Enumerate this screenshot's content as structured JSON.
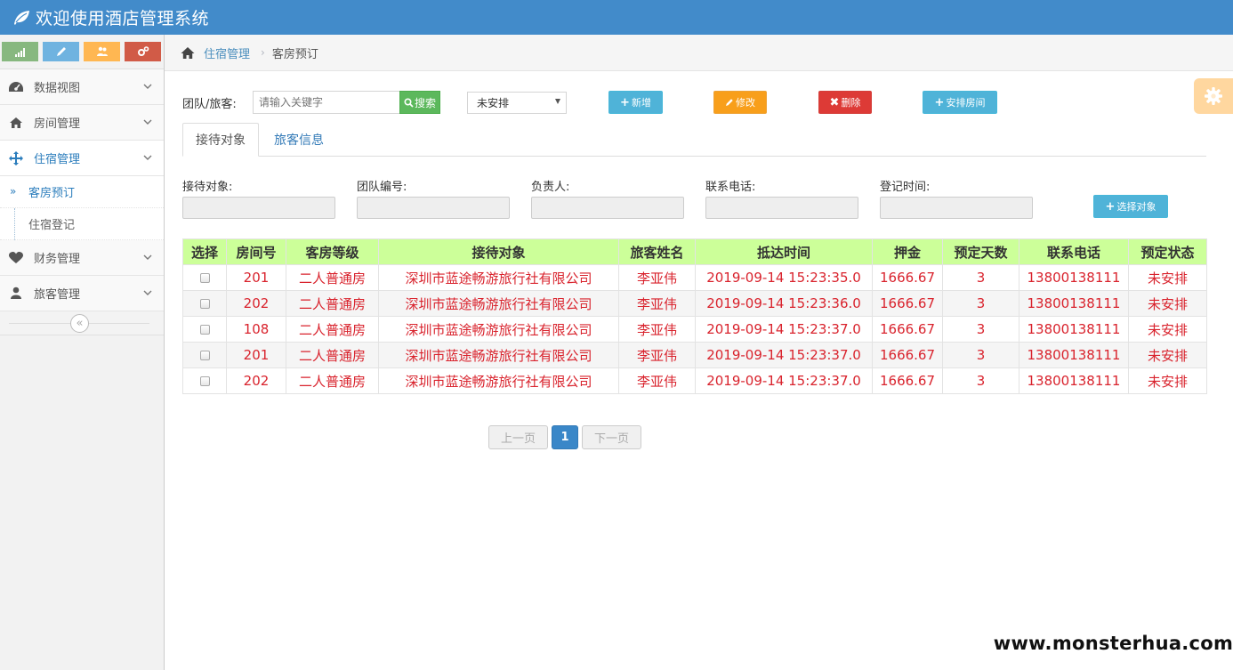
{
  "app": {
    "title": "欢迎使用酒店管理系统",
    "brand_color": "#428bca"
  },
  "shortcuts": [
    {
      "icon": "signal-icon",
      "color": "#87b87f"
    },
    {
      "icon": "pencil-icon",
      "color": "#6fb3e0"
    },
    {
      "icon": "users-icon",
      "color": "#ffb752"
    },
    {
      "icon": "cogs-icon",
      "color": "#d15b47"
    }
  ],
  "sidebar": {
    "items": [
      {
        "label": "数据视图",
        "icon": "dashboard-icon"
      },
      {
        "label": "房间管理",
        "icon": "home-icon"
      },
      {
        "label": "住宿管理",
        "icon": "move-arrows-icon",
        "open": true,
        "children": [
          {
            "label": "客房预订",
            "active": true
          },
          {
            "label": "住宿登记"
          }
        ]
      },
      {
        "label": "财务管理",
        "icon": "heart-icon"
      },
      {
        "label": "旅客管理",
        "icon": "user-icon"
      }
    ],
    "collapse_glyph": "«"
  },
  "breadcrumb": {
    "parent": "住宿管理",
    "current": "客房预订"
  },
  "toolbar": {
    "search_label": "团队/旅客:",
    "search_placeholder": "请输入关键字",
    "search_button": "搜索",
    "status_select_value": "未安排",
    "add_label": "新增",
    "edit_label": "修改",
    "delete_label": "删除",
    "arrange_label": "安排房间"
  },
  "tabs": {
    "reception": "接待对象",
    "traveler_info": "旅客信息"
  },
  "form": {
    "reception_label": "接待对象:",
    "team_no_label": "团队编号:",
    "leader_label": "负责人:",
    "phone_label": "联系电话:",
    "register_time_label": "登记时间:",
    "choose_button": "选择对象"
  },
  "table": {
    "headers": [
      "选择",
      "房间号",
      "客房等级",
      "接待对象",
      "旅客姓名",
      "抵达时间",
      "押金",
      "预定天数",
      "联系电话",
      "预定状态"
    ],
    "rows": [
      [
        "",
        "201",
        "二人普通房",
        "深圳市蓝途畅游旅行社有限公司",
        "李亚伟",
        "2019-09-14 15:23:35.0",
        "1666.67",
        "3",
        "13800138111",
        "未安排"
      ],
      [
        "",
        "202",
        "二人普通房",
        "深圳市蓝途畅游旅行社有限公司",
        "李亚伟",
        "2019-09-14 15:23:36.0",
        "1666.67",
        "3",
        "13800138111",
        "未安排"
      ],
      [
        "",
        "108",
        "二人普通房",
        "深圳市蓝途畅游旅行社有限公司",
        "李亚伟",
        "2019-09-14 15:23:37.0",
        "1666.67",
        "3",
        "13800138111",
        "未安排"
      ],
      [
        "",
        "201",
        "二人普通房",
        "深圳市蓝途畅游旅行社有限公司",
        "李亚伟",
        "2019-09-14 15:23:37.0",
        "1666.67",
        "3",
        "13800138111",
        "未安排"
      ],
      [
        "",
        "202",
        "二人普通房",
        "深圳市蓝途畅游旅行社有限公司",
        "李亚伟",
        "2019-09-14 15:23:37.0",
        "1666.67",
        "3",
        "13800138111",
        "未安排"
      ]
    ],
    "header_color": "#ccff99",
    "cell_text_color": "#d9232d"
  },
  "pager": {
    "prev": "上一页",
    "current": "1",
    "next": "下一页"
  },
  "watermark": "www.monsterhua.com"
}
